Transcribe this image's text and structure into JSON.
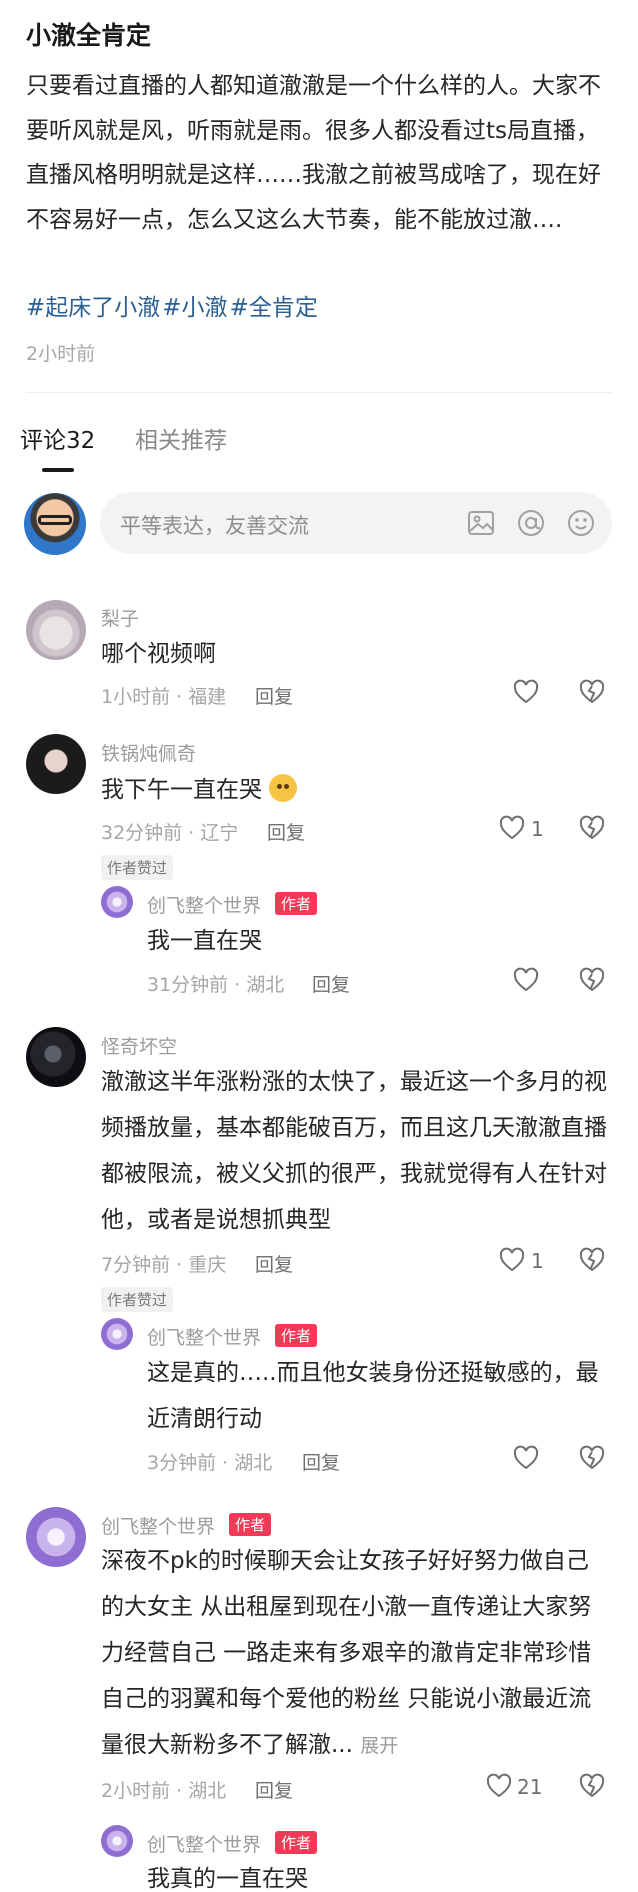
{
  "post": {
    "title": "小澈全肯定",
    "body": "只要看过直播的人都知道澈澈是一个什么样的人。大家不要听风就是风，听雨就是雨。很多人都没看过ts局直播，直播风格明明就是这样……我澈之前被骂成啥了，现在好不容易好一点，怎么又这么大节奏，能不能放过澈….",
    "hashtags": [
      "#起床了小澈",
      "#小澈",
      "#全肯定"
    ],
    "time": "2小时前"
  },
  "tabs": {
    "comments": "评论32",
    "related": "相关推荐"
  },
  "composer": {
    "placeholder": "平等表达，友善交流"
  },
  "labels": {
    "reply": "回复",
    "author_liked": "作者赞过",
    "author": "作者",
    "expand": "展开"
  },
  "comments": [
    {
      "name": "梨子",
      "text": "哪个视频啊",
      "meta": "1小时前 · 福建",
      "likes": ""
    },
    {
      "name": "铁锅炖佩奇",
      "text": "我下午一直在哭",
      "meta": "32分钟前 · 辽宁",
      "likes": "1",
      "reply": {
        "name": "创飞整个世界",
        "text": "我一直在哭",
        "meta": "31分钟前 · 湖北",
        "likes": ""
      }
    },
    {
      "name": "怪奇坏空",
      "text": "澈澈这半年涨粉涨的太快了，最近这一个多月的视频播放量，基本都能破百万，而且这几天澈澈直播都被限流，被义父抓的很严，我就觉得有人在针对他，或者是说想抓典型",
      "meta": "7分钟前 · 重庆",
      "likes": "1",
      "reply": {
        "name": "创飞整个世界",
        "text": "这是真的…..而且他女装身份还挺敏感的，最近清朗行动",
        "meta": "3分钟前 · 湖北",
        "likes": ""
      }
    },
    {
      "name": "创飞整个世界",
      "text": "深夜不pk的时候聊天会让女孩子好好努力做自己的大女主 从出租屋到现在小澈一直传递让大家努力经营自己 一路走来有多艰辛的澈肯定非常珍惜自己的羽翼和每个爱他的粉丝 只能说小澈最近流量很大新粉多不了解澈...",
      "meta": "2小时前 · 湖北",
      "likes": "21",
      "reply": {
        "name": "创飞整个世界",
        "text": "我真的一直在哭"
      }
    }
  ]
}
